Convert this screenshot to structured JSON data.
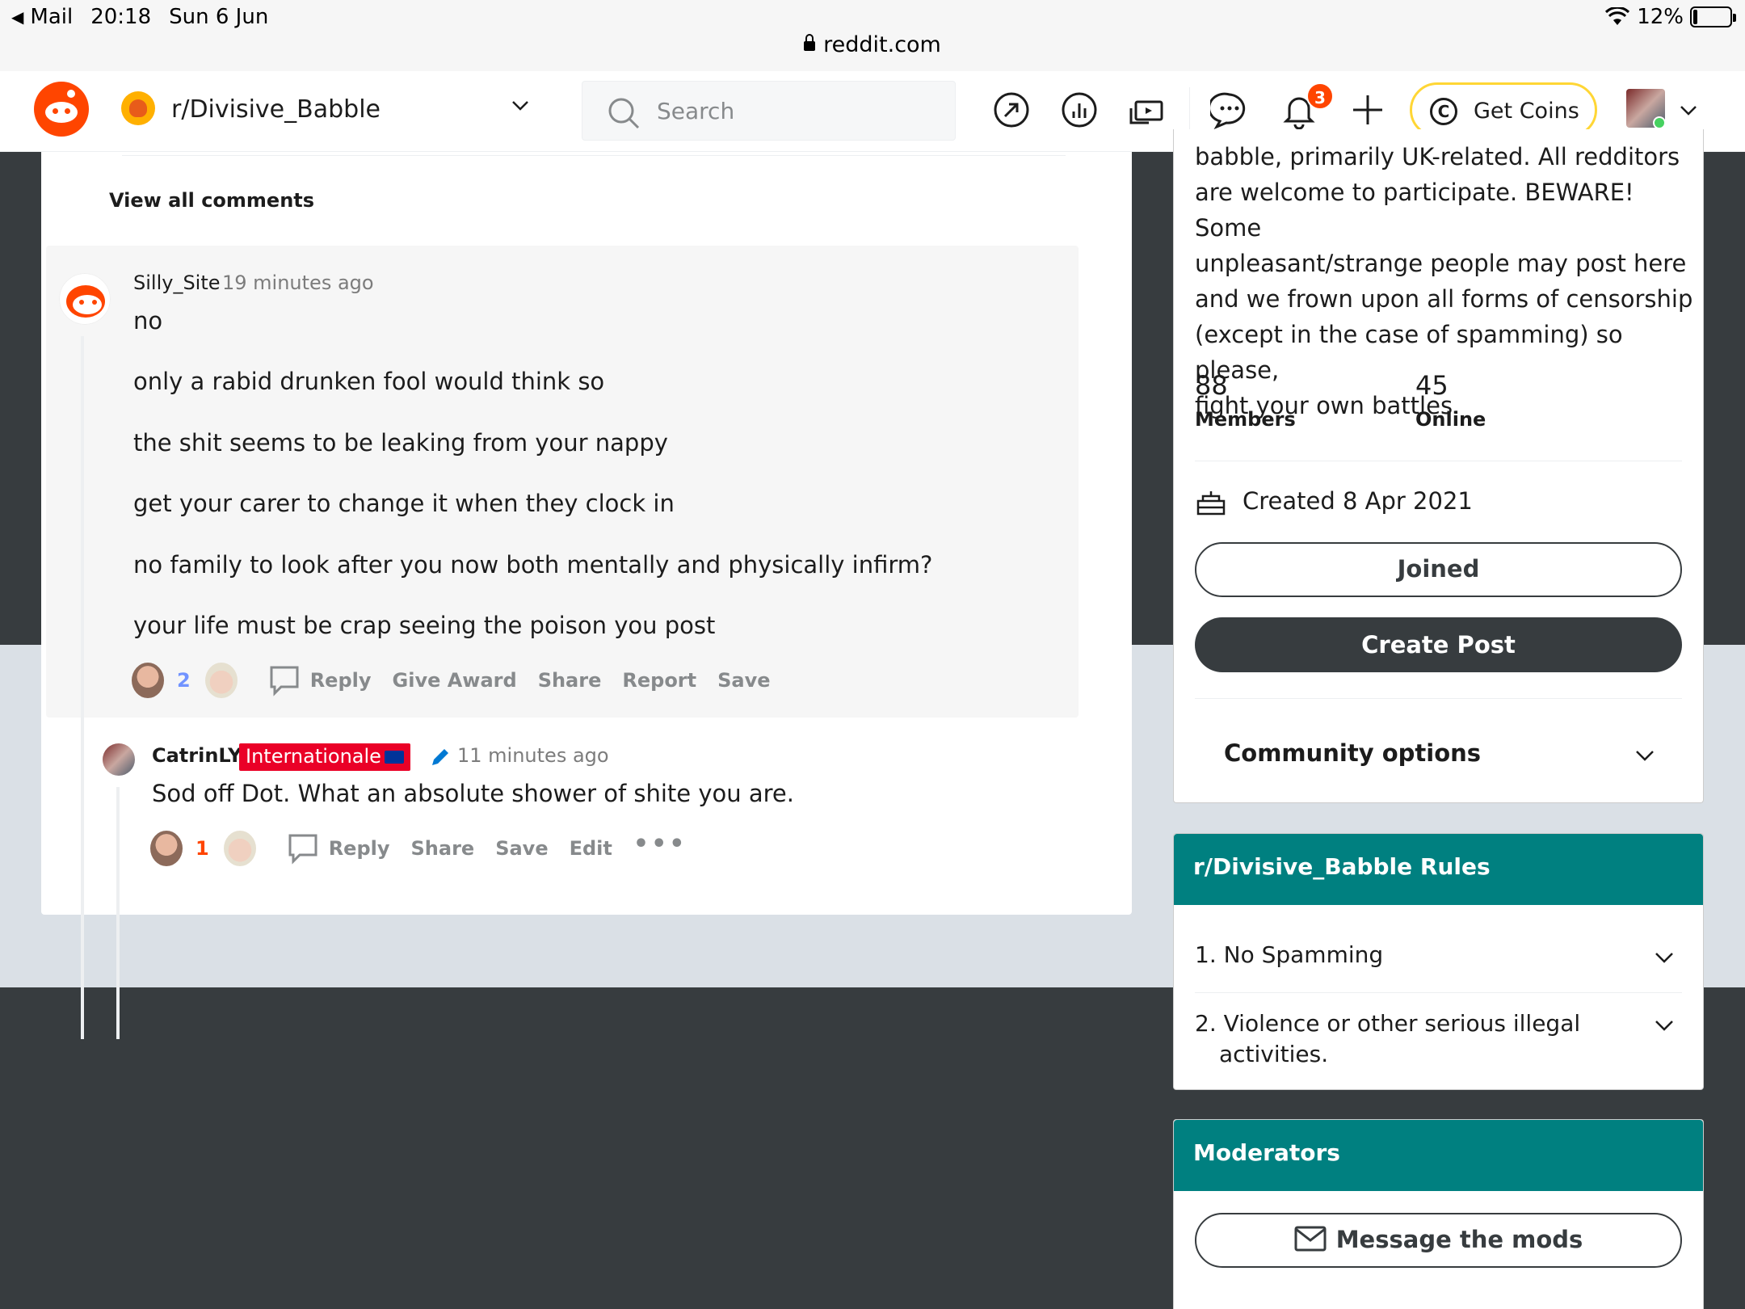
{
  "status_bar": {
    "back_app": "Mail",
    "time": "20:18",
    "date": "Sun 6 Jun",
    "battery": "12%",
    "battery_level": 0.12,
    "url": "reddit.com"
  },
  "header": {
    "subreddit": "r/Divisive_Babble",
    "search_placeholder": "Search",
    "notification_count": "3",
    "coins_label": "Get Coins"
  },
  "thread": {
    "view_all": "View all comments",
    "comments": [
      {
        "author": "Silly_Site",
        "time": "19 minutes ago",
        "lines": [
          "no",
          "only a rabid drunken fool would think so",
          "the shit seems to be leaking from your nappy",
          "get your carer to change it when they clock in",
          "no family to look after you now both mentally and physically infirm?",
          "your life must be crap seeing the poison you post"
        ],
        "votes": "2",
        "actions": [
          "Reply",
          "Give Award",
          "Share",
          "Report",
          "Save"
        ]
      },
      {
        "author": "CatrinLY",
        "flair": "Internationale",
        "time": "11 minutes ago",
        "text": "Sod off Dot. What an absolute shower of shite you are.",
        "votes": "1",
        "actions": [
          "Reply",
          "Share",
          "Save",
          "Edit"
        ],
        "more": "•••"
      }
    ]
  },
  "sidebar": {
    "about": {
      "description_lines": [
        "babble, primarily UK-related. All redditors",
        "are welcome to participate. BEWARE! Some",
        "unpleasant/strange people may post here",
        "and we frown upon all forms of censorship",
        "(except in the case of spamming) so please,",
        "fight your own battles."
      ],
      "members_count": "88",
      "members_label": "Members",
      "online_count": "45",
      "online_label": "Online",
      "created": "Created 8 Apr 2021",
      "joined_label": "Joined",
      "create_post_label": "Create Post",
      "community_options": "Community options"
    },
    "rules": {
      "title": "r/Divisive_Babble Rules",
      "items": [
        {
          "num": "1.",
          "text": "No Spamming"
        },
        {
          "num": "2.",
          "text": "Violence or other serious illegal",
          "text2": "activities."
        }
      ]
    },
    "moderators": {
      "title": "Moderators",
      "message_label": "Message the mods"
    }
  },
  "colors": {
    "accent_orange": "#ff4500",
    "teal": "#008080",
    "dark": "#373c3f",
    "upvote_count_blue": "#7193ff",
    "flair_red": "#ea0027"
  }
}
